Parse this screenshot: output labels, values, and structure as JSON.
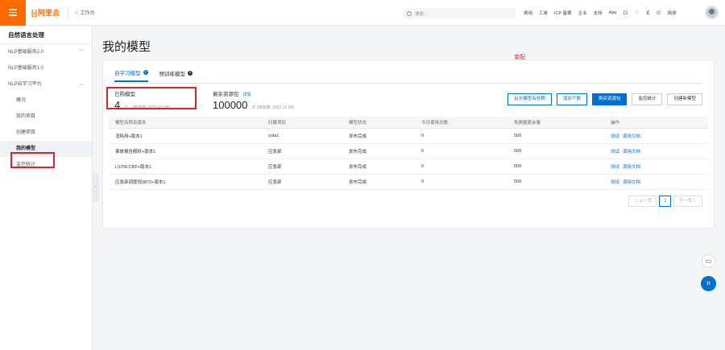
{
  "topbar": {
    "logo_text": "阿里云",
    "workbench": "工作台",
    "search_placeholder": "搜索...",
    "nav": [
      "费用",
      "工单",
      "ICP 备案",
      "企业",
      "支持",
      "App"
    ],
    "lang": "简体",
    "accent": "#ff6a00"
  },
  "sidebar": {
    "title": "自然语言处理",
    "items": [
      {
        "label": "NLP基础服务2.0",
        "expandable": true
      },
      {
        "label": "NLP基础服务1.0"
      },
      {
        "label": "NLP自学习平台",
        "expandable": true
      },
      {
        "label": "概况"
      },
      {
        "label": "我的项目"
      },
      {
        "label": "创建项目"
      },
      {
        "label": "我的模型"
      },
      {
        "label": "监控统计"
      }
    ]
  },
  "main": {
    "title": "我的模型",
    "tabs": [
      "自学习模型",
      "预训练模型"
    ],
    "stat_bought": {
      "label": "已购模型",
      "value": "4",
      "unit": "个",
      "expiry": "(有效期: 2022-03-08)"
    },
    "stat_remaining": {
      "label": "剩余资源包",
      "link": "详情",
      "value": "100000",
      "unit": "次",
      "expiry": "(有效期: 2022-11-09)"
    },
    "annotation": "变配",
    "buttons": [
      "延长模型有效期",
      "增加个数",
      "购买资源包",
      "监控统计",
      "创建新模型"
    ],
    "table": {
      "headers": [
        "模型名称及版本",
        "归属项目",
        "模型状态",
        "今日使用次数",
        "免费额度余量",
        "操作"
      ],
      "rows": [
        [
          "消耗用+版本1",
          "yufa1",
          "发布完成",
          "0",
          "500"
        ],
        [
          "事故报告解析+版本1",
          "应急部",
          "发布完成",
          "0",
          "500"
        ],
        [
          "LSTM-CRF+版本1",
          "应急部",
          "发布完成",
          "0",
          "500"
        ],
        [
          "应急部调度规3872+版本1",
          "应急部",
          "发布完成",
          "0",
          "500"
        ]
      ],
      "ops": [
        "测试",
        "调用文档"
      ]
    },
    "pager": {
      "prev": "〈 上一页",
      "current": "1",
      "next": "下一页 〉"
    }
  },
  "colors": {
    "primary": "#0070cc",
    "annotation": "#e0202a"
  }
}
